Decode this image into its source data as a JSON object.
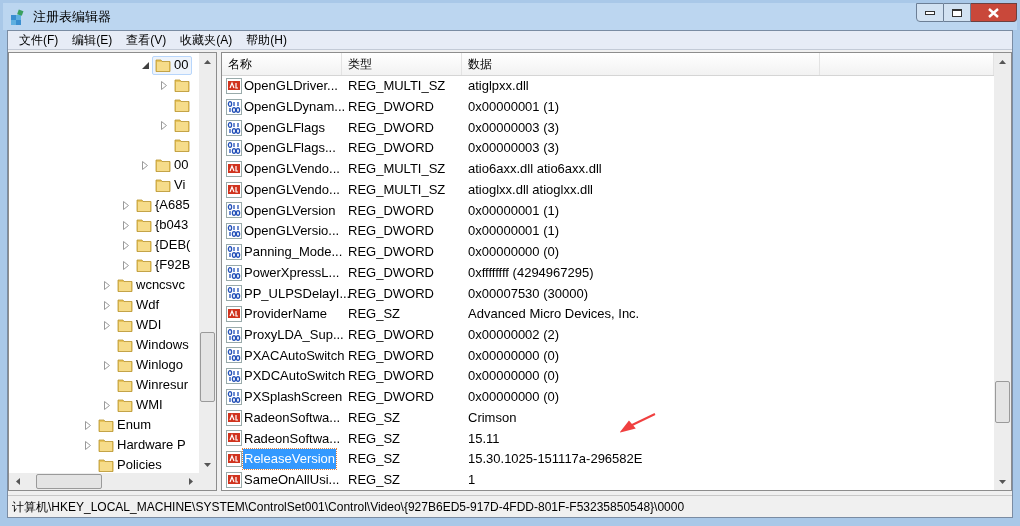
{
  "window": {
    "title": "注册表编辑器"
  },
  "menu": [
    {
      "label": "文件(F)"
    },
    {
      "label": "编辑(E)"
    },
    {
      "label": "查看(V)"
    },
    {
      "label": "收藏夹(A)"
    },
    {
      "label": "帮助(H)"
    }
  ],
  "tree": {
    "items": [
      {
        "children": [
          {
            "children": [
              {
                "children": [
                  {
                    "label": "00",
                    "expanded": true,
                    "selected": true,
                    "children": [
                      {
                        "expandable": true,
                        "selected": false
                      },
                      {
                        "expandable": false,
                        "selected": false
                      },
                      {
                        "expandable": true,
                        "selected": false
                      },
                      {
                        "expandable": false,
                        "selected": false
                      }
                    ]
                  },
                  {
                    "label": "00",
                    "expandable": true,
                    "selected": false
                  },
                  {
                    "label": "Vi",
                    "expandable": false,
                    "selected": false
                  }
                ]
              },
              {
                "label": "{A685",
                "expandable": true,
                "selected": false
              },
              {
                "label": "{b043",
                "expandable": true,
                "selected": false
              },
              {
                "label": "{DEB(",
                "expandable": true,
                "selected": false
              },
              {
                "label": "{F92B",
                "expandable": true,
                "selected": false
              }
            ]
          },
          {
            "label": "wcncsvc",
            "expandable": true,
            "selected": false
          },
          {
            "label": "Wdf",
            "expandable": true,
            "selected": false
          },
          {
            "label": "WDI",
            "expandable": true,
            "selected": false
          },
          {
            "label": "Windows",
            "expandable": false,
            "selected": false
          },
          {
            "label": "Winlogo",
            "expandable": true,
            "selected": false
          },
          {
            "label": "Winresur",
            "expandable": false,
            "selected": false
          },
          {
            "label": "WMI",
            "expandable": true,
            "selected": false
          }
        ]
      },
      {
        "label": "Enum",
        "expandable": true,
        "selected": false
      },
      {
        "label": "Hardware P",
        "expandable": true,
        "selected": false
      },
      {
        "label": "Policies",
        "expandable": false,
        "selected": false
      }
    ]
  },
  "table": {
    "columns": [
      "名称",
      "类型",
      "数据"
    ],
    "rows": [
      {
        "kind": "string",
        "name": "OpenGLDriver...",
        "type": "REG_MULTI_SZ",
        "data": "atiglpxx.dll",
        "selected": false
      },
      {
        "kind": "binary",
        "name": "OpenGLDynam...",
        "type": "REG_DWORD",
        "data": "0x00000001 (1)",
        "selected": false
      },
      {
        "kind": "binary",
        "name": "OpenGLFlags",
        "type": "REG_DWORD",
        "data": "0x00000003 (3)",
        "selected": false
      },
      {
        "kind": "binary",
        "name": "OpenGLFlags...",
        "type": "REG_DWORD",
        "data": "0x00000003 (3)",
        "selected": false
      },
      {
        "kind": "string",
        "name": "OpenGLVendo...",
        "type": "REG_MULTI_SZ",
        "data": "atio6axx.dll atio6axx.dll",
        "selected": false
      },
      {
        "kind": "string",
        "name": "OpenGLVendo...",
        "type": "REG_MULTI_SZ",
        "data": "atioglxx.dll atioglxx.dll",
        "selected": false
      },
      {
        "kind": "binary",
        "name": "OpenGLVersion",
        "type": "REG_DWORD",
        "data": "0x00000001 (1)",
        "selected": false
      },
      {
        "kind": "binary",
        "name": "OpenGLVersio...",
        "type": "REG_DWORD",
        "data": "0x00000001 (1)",
        "selected": false
      },
      {
        "kind": "binary",
        "name": "Panning_Mode...",
        "type": "REG_DWORD",
        "data": "0x00000000 (0)",
        "selected": false
      },
      {
        "kind": "binary",
        "name": "PowerXpressL...",
        "type": "REG_DWORD",
        "data": "0xffffffff (4294967295)",
        "selected": false
      },
      {
        "kind": "binary",
        "name": "PP_ULPSDelayI...",
        "type": "REG_DWORD",
        "data": "0x00007530 (30000)",
        "selected": false
      },
      {
        "kind": "string",
        "name": "ProviderName",
        "type": "REG_SZ",
        "data": "Advanced Micro Devices, Inc.",
        "selected": false
      },
      {
        "kind": "binary",
        "name": "ProxyLDA_Sup...",
        "type": "REG_DWORD",
        "data": "0x00000002 (2)",
        "selected": false
      },
      {
        "kind": "binary",
        "name": "PXACAutoSwitch",
        "type": "REG_DWORD",
        "data": "0x00000000 (0)",
        "selected": false
      },
      {
        "kind": "binary",
        "name": "PXDCAutoSwitch",
        "type": "REG_DWORD",
        "data": "0x00000000 (0)",
        "selected": false
      },
      {
        "kind": "binary",
        "name": "PXSplashScreen",
        "type": "REG_DWORD",
        "data": "0x00000000 (0)",
        "selected": false
      },
      {
        "kind": "string",
        "name": "RadeonSoftwa...",
        "type": "REG_SZ",
        "data": "Crimson",
        "selected": false
      },
      {
        "kind": "string",
        "name": "RadeonSoftwa...",
        "type": "REG_SZ",
        "data": "15.11",
        "selected": false
      },
      {
        "kind": "string",
        "name": "ReleaseVersion",
        "type": "REG_SZ",
        "data": "15.30.1025-151117a-296582E",
        "selected": true
      },
      {
        "kind": "string",
        "name": "SameOnAllUsi...",
        "type": "REG_SZ",
        "data": "1",
        "selected": false
      }
    ]
  },
  "status_bar": "计算机\\HKEY_LOCAL_MACHINE\\SYSTEM\\ControlSet001\\Control\\Video\\{927B6ED5-917D-4FDD-801F-F53235850548}\\0000"
}
